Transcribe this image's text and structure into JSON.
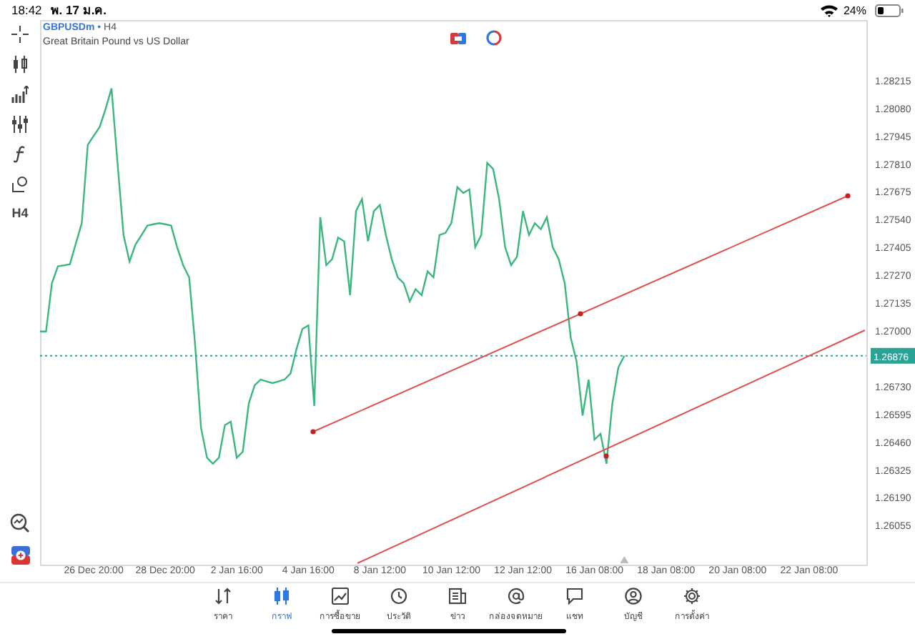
{
  "status_bar": {
    "time": "18:42",
    "date": "พ. 17 ม.ค.",
    "battery": "24%"
  },
  "toolbar": {
    "timeframe": "H4"
  },
  "chart_header": {
    "symbol": "GBPUSDm",
    "separator": "•",
    "timeframe": "H4",
    "description": "Great Britain Pound vs US Dollar"
  },
  "current_price": "1.26876",
  "chart_data": {
    "type": "line",
    "categories": [
      null,
      null,
      null,
      null,
      null,
      null,
      null,
      null,
      null,
      "26 Dec 20:00",
      null,
      null,
      null,
      null,
      null,
      null,
      null,
      null,
      null,
      null,
      null,
      "28 Dec 20:00",
      null,
      null,
      null,
      null,
      null,
      null,
      null,
      null,
      null,
      null,
      null,
      "2 Jan 16:00",
      null,
      null,
      null,
      null,
      null,
      null,
      null,
      null,
      null,
      null,
      null,
      "4 Jan 16:00",
      null,
      null,
      null,
      null,
      null,
      null,
      null,
      null,
      null,
      null,
      null,
      "8 Jan 12:00",
      null,
      null,
      null,
      null,
      null,
      null,
      null,
      null,
      null,
      null,
      null,
      "10 Jan 12:00",
      null,
      null,
      null,
      null,
      null,
      null,
      null,
      null,
      null,
      null,
      null,
      "12 Jan 12:00",
      null,
      null,
      null,
      null,
      null,
      null,
      null,
      null,
      null,
      null,
      null,
      "16 Jan 08:00",
      null,
      null,
      null,
      null,
      null,
      null,
      null,
      null,
      null,
      null,
      null,
      "18 Jan 08:00",
      null,
      null,
      null,
      null,
      null,
      null,
      null,
      null,
      null,
      null,
      null,
      "20 Jan 08:00",
      null,
      null,
      null,
      null,
      null,
      null,
      null,
      null,
      null,
      null,
      null,
      "22 Jan 08:00",
      null,
      null,
      null,
      null,
      null,
      null,
      null,
      null,
      null
    ],
    "series": [
      {
        "color": "#3cb67e",
        "values": [
          1.26994,
          1.26994,
          1.27228,
          1.2731,
          1.27315,
          1.27321,
          1.2742,
          1.2752,
          1.279,
          1.27943,
          1.27987,
          1.28075,
          1.28174,
          1.27812,
          1.27462,
          1.27333,
          1.27415,
          1.27461,
          1.27508,
          1.27514,
          1.2752,
          1.27514,
          1.27508,
          1.27403,
          1.27316,
          1.27257,
          1.26936,
          1.26527,
          1.26381,
          1.26352,
          1.26381,
          1.26539,
          1.26556,
          1.26381,
          1.2641,
          1.26644,
          1.26732,
          1.26761,
          1.26752,
          1.26743,
          1.26752,
          1.26761,
          1.2679,
          1.26907,
          1.27006,
          1.27024,
          1.26632,
          1.27549,
          1.27316,
          1.27345,
          1.2745,
          1.27432,
          1.2717,
          1.27578,
          1.27637,
          1.27432,
          1.27578,
          1.27608,
          1.27462,
          1.27345,
          1.27257,
          1.27228,
          1.2714,
          1.27199,
          1.2717,
          1.27286,
          1.27257,
          1.27462,
          1.27473,
          1.2752,
          1.27695,
          1.27666,
          1.27684,
          1.27403,
          1.27462,
          1.27812,
          1.27783,
          1.27637,
          1.27403,
          1.27316,
          1.27357,
          1.27578,
          1.27462,
          1.2752,
          1.27491,
          1.27549,
          1.27403,
          1.27345,
          1.27228,
          1.26965,
          1.26848,
          1.26586,
          1.26761,
          1.26469,
          1.26498,
          1.26352,
          1.26644,
          1.26819,
          1.26876,
          null,
          null,
          null,
          null,
          null,
          null,
          null,
          null,
          null,
          null,
          null,
          null,
          null,
          null,
          null,
          null,
          null,
          null,
          null,
          null,
          null,
          null,
          null,
          null,
          null,
          null,
          null,
          null,
          null,
          null,
          null,
          null,
          null,
          null,
          null,
          null,
          null,
          null,
          null,
          null
        ]
      }
    ],
    "ylim": [
      1.25862,
      1.28506
    ],
    "ref_lines": [
      {
        "axis": "y",
        "value": 1.26876,
        "color": "#2aa394"
      }
    ],
    "yticks": [
      {
        "value": 1.28215,
        "label": "1.28215"
      },
      {
        "value": 1.2808,
        "label": "1.28080"
      },
      {
        "value": 1.27945,
        "label": "1.27945"
      },
      {
        "value": 1.2781,
        "label": "1.27810"
      },
      {
        "value": 1.27675,
        "label": "1.27675"
      },
      {
        "value": 1.2754,
        "label": "1.27540"
      },
      {
        "value": 1.27405,
        "label": "1.27405"
      },
      {
        "value": 1.2727,
        "label": "1.27270"
      },
      {
        "value": 1.27135,
        "label": "1.27135"
      },
      {
        "value": 1.27,
        "label": "1.27000"
      },
      {
        "value": 1.2673,
        "label": "1.26730"
      },
      {
        "value": 1.26595,
        "label": "1.26595"
      },
      {
        "value": 1.2646,
        "label": "1.26460"
      },
      {
        "value": 1.26325,
        "label": "1.26325"
      },
      {
        "value": 1.2619,
        "label": "1.26190"
      },
      {
        "value": 1.26055,
        "label": "1.26055"
      }
    ]
  },
  "bottom_nav": [
    {
      "label": "ราคา",
      "selected": false
    },
    {
      "label": "กราฟ",
      "selected": true
    },
    {
      "label": "การซื้อขาย",
      "selected": false
    },
    {
      "label": "ประวัติ",
      "selected": false
    },
    {
      "label": "ข่าว",
      "selected": false
    },
    {
      "label": "กล่องจดหมาย",
      "selected": false
    },
    {
      "label": "แชท",
      "selected": false
    },
    {
      "label": "บัญชี",
      "selected": false
    },
    {
      "label": "การตั้งค่า",
      "selected": false
    }
  ]
}
